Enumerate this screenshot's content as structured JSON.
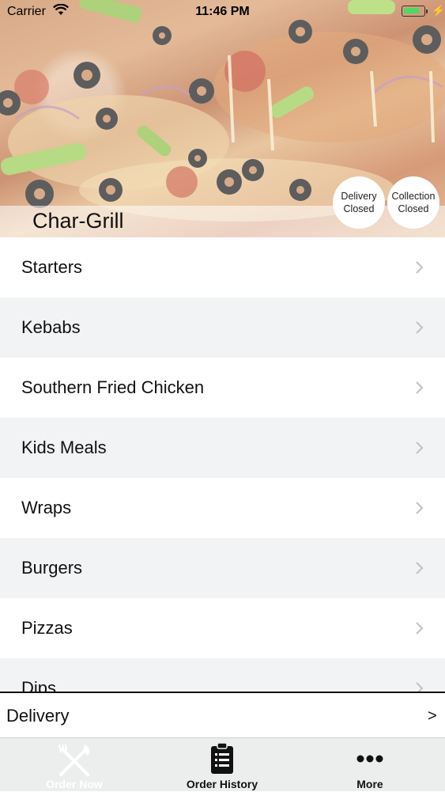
{
  "status_bar": {
    "carrier": "Carrier",
    "time": "11:46 PM"
  },
  "header": {
    "restaurant_name": "Char-Grill",
    "delivery_status": {
      "line1": "Delivery",
      "line2": "Closed"
    },
    "collection_status": {
      "line1": "Collection",
      "line2": "Closed"
    }
  },
  "menu": {
    "categories": [
      {
        "label": "Starters"
      },
      {
        "label": "Kebabs"
      },
      {
        "label": "Southern Fried Chicken"
      },
      {
        "label": "Kids Meals"
      },
      {
        "label": "Wraps"
      },
      {
        "label": "Burgers"
      },
      {
        "label": "Pizzas"
      },
      {
        "label": "Dips"
      }
    ]
  },
  "order_type_bar": {
    "label": "Delivery",
    "arrow": ">"
  },
  "tabs": [
    {
      "label": "Order Now",
      "icon": "fork-knife-icon"
    },
    {
      "label": "Order History",
      "icon": "clipboard-list-icon"
    },
    {
      "label": "More",
      "icon": "more-dots-icon"
    }
  ],
  "colors": {
    "battery": "#4cd964",
    "row_alt": "#f2f3f4",
    "tabbar": "#eceded"
  }
}
